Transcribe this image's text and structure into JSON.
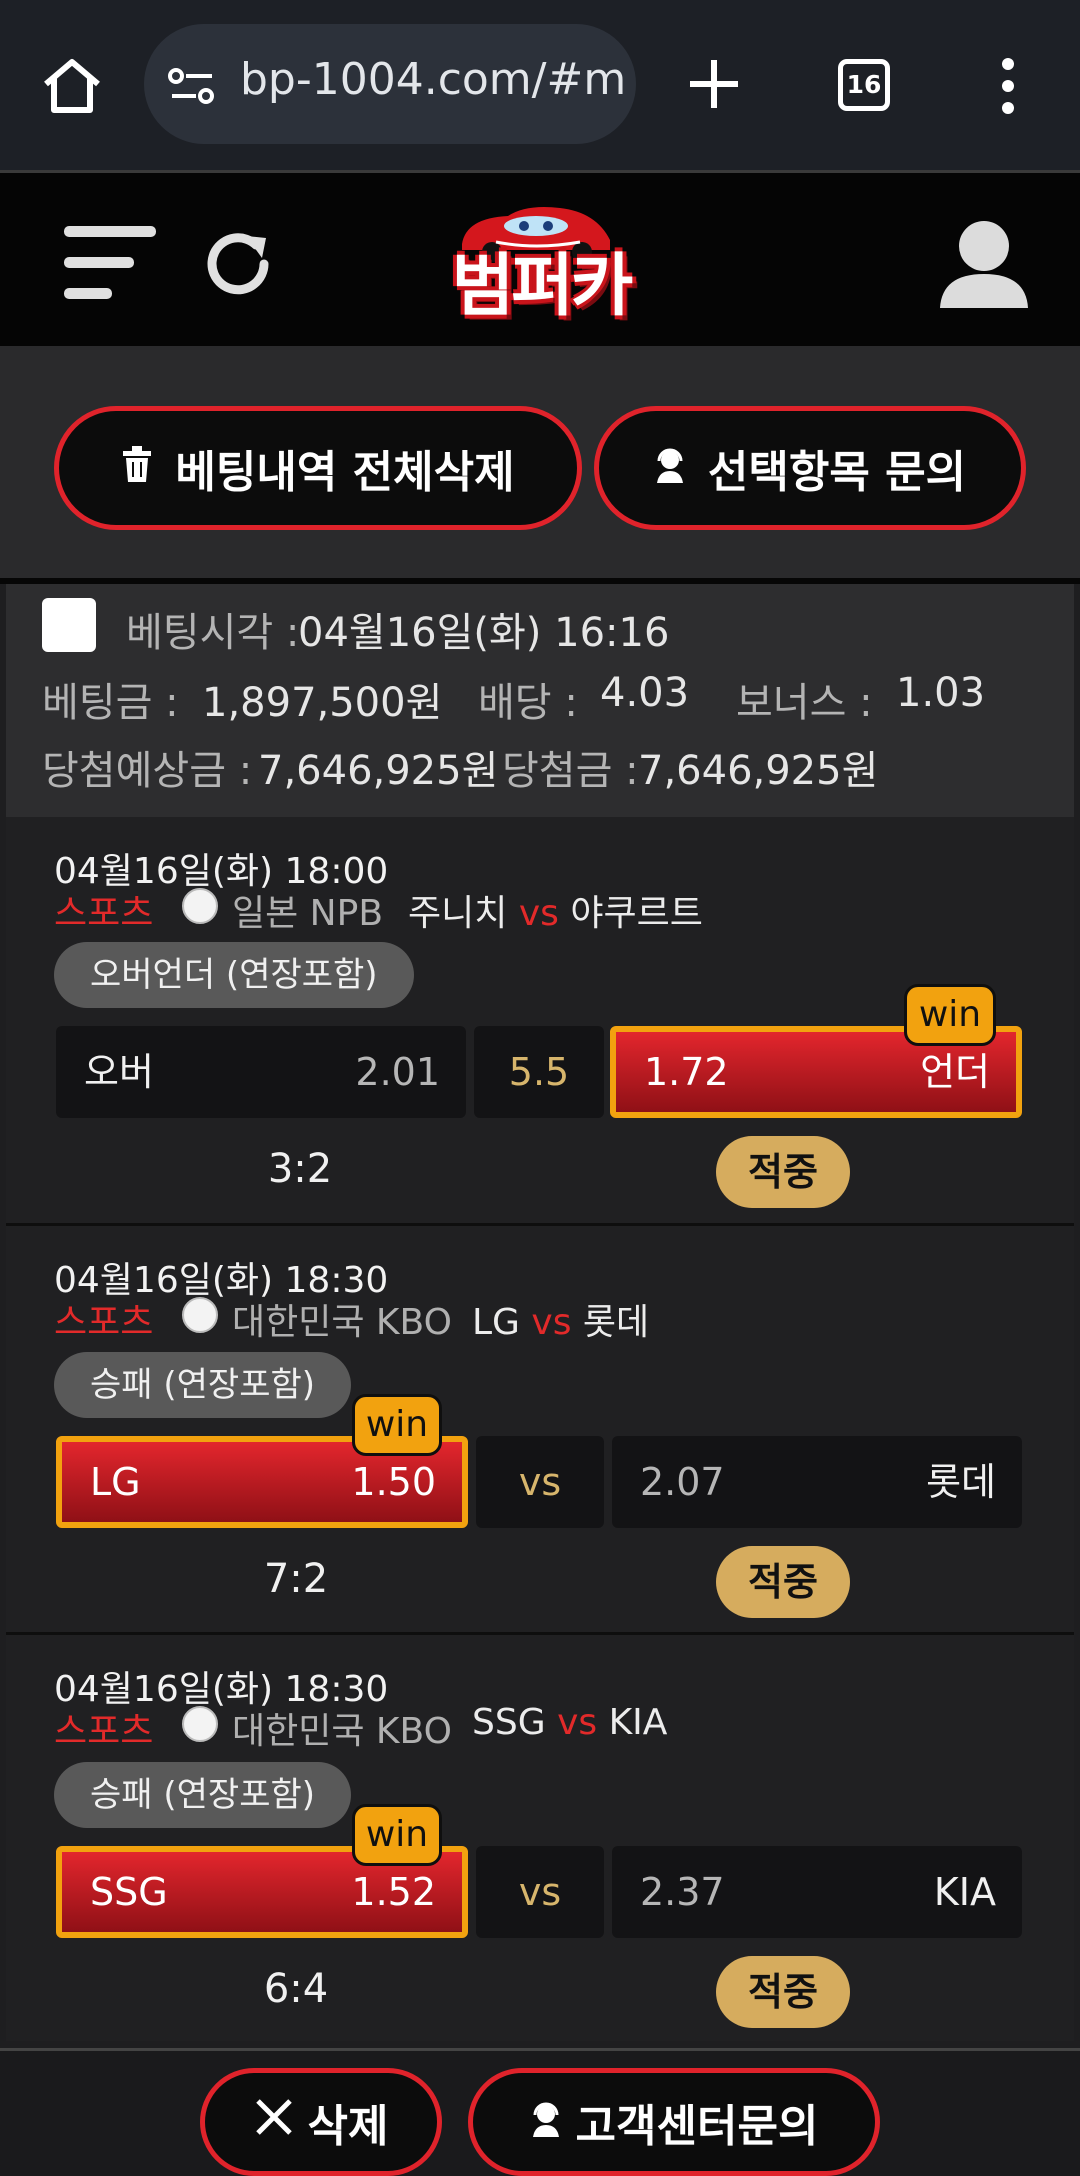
{
  "browser": {
    "url": "bp-1004.com/#m",
    "tab_count": "16"
  },
  "header": {
    "logo_text": "범퍼카"
  },
  "actions": {
    "delete_all_label": "베팅내역 전체삭제",
    "inquiry_selected_label": "선택항목 문의"
  },
  "bet_summary": {
    "time_label": "베팅시각 :",
    "time_value": "04월16일(화) 16:16",
    "amount_label": "베팅금 :",
    "amount_value": "1,897,500원",
    "odds_label": "배당 :",
    "odds_value": "4.03",
    "bonus_label": "보너스 :",
    "bonus_value": "1.03",
    "expected_label": "당첨예상금 :",
    "expected_value": "7,646,925원",
    "won_label": "당첨금 :",
    "won_value": "7,646,925원"
  },
  "matches": [
    {
      "datetime": "04월16일(화) 18:00",
      "sport": "스포츠",
      "league": "일본 NPB",
      "home": "주니치",
      "vs": "vs",
      "away": "야쿠르트",
      "market": "오버언더 (연장포함)",
      "left_label": "오버",
      "left_odds": "2.01",
      "middle": "5.5",
      "right_odds": "1.72",
      "right_label": "언더",
      "win_label": "win",
      "score": "3:2",
      "result": "적중"
    },
    {
      "datetime": "04월16일(화) 18:30",
      "sport": "스포츠",
      "league": "대한민국 KBO",
      "home": "LG",
      "vs": "vs",
      "away": "롯데",
      "market": "승패 (연장포함)",
      "left_label": "LG",
      "left_odds": "1.50",
      "middle": "vs",
      "right_odds": "2.07",
      "right_label": "롯데",
      "win_label": "win",
      "score": "7:2",
      "result": "적중"
    },
    {
      "datetime": "04월16일(화) 18:30",
      "sport": "스포츠",
      "league": "대한민국 KBO",
      "home": "SSG",
      "vs": "vs",
      "away": "KIA",
      "market": "승패 (연장포함)",
      "left_label": "SSG",
      "left_odds": "1.52",
      "middle": "vs",
      "right_odds": "2.37",
      "right_label": "KIA",
      "win_label": "win",
      "score": "6:4",
      "result": "적중"
    }
  ],
  "bottom": {
    "delete_label": "삭제",
    "support_label": "고객센터문의"
  },
  "colors": {
    "accent_red": "#e0232b",
    "win_orange": "#f2a20f",
    "hit_gold": "#d6ac5e"
  }
}
